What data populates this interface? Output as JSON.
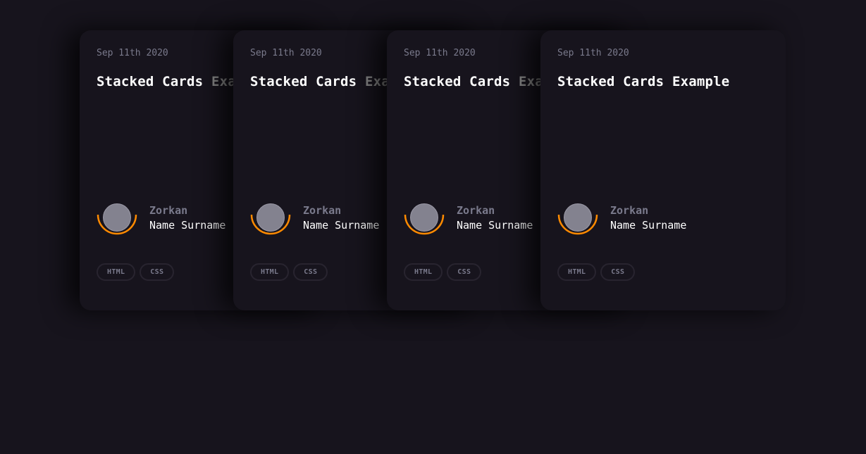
{
  "cards": [
    {
      "date": "Sep 11th 2020",
      "title_part1": "Stacked Cards",
      "title_part2": "Example",
      "author_label": "Zorkan",
      "author_name": "Name Surname",
      "tags": [
        "HTML",
        "CSS"
      ]
    },
    {
      "date": "Sep 11th 2020",
      "title_part1": "Stacked Cards",
      "title_part2": "Example",
      "author_label": "Zorkan",
      "author_name": "Name Surname",
      "tags": [
        "HTML",
        "CSS"
      ]
    },
    {
      "date": "Sep 11th 2020",
      "title_part1": "Stacked Cards",
      "title_part2": "Example",
      "author_label": "Zorkan",
      "author_name": "Name Surname",
      "tags": [
        "HTML",
        "CSS"
      ]
    },
    {
      "date": "Sep 11th 2020",
      "title_part1": "Stacked Cards",
      "title_part2": "Example",
      "author_label": "Zorkan",
      "author_name": "Name Surname",
      "tags": [
        "HTML",
        "CSS"
      ]
    }
  ],
  "colors": {
    "background": "#17141d",
    "accent_ring": "#ff8a00",
    "avatar": "#83828f",
    "muted_text": "#7a7a8c",
    "title_text": "#ffffff"
  }
}
